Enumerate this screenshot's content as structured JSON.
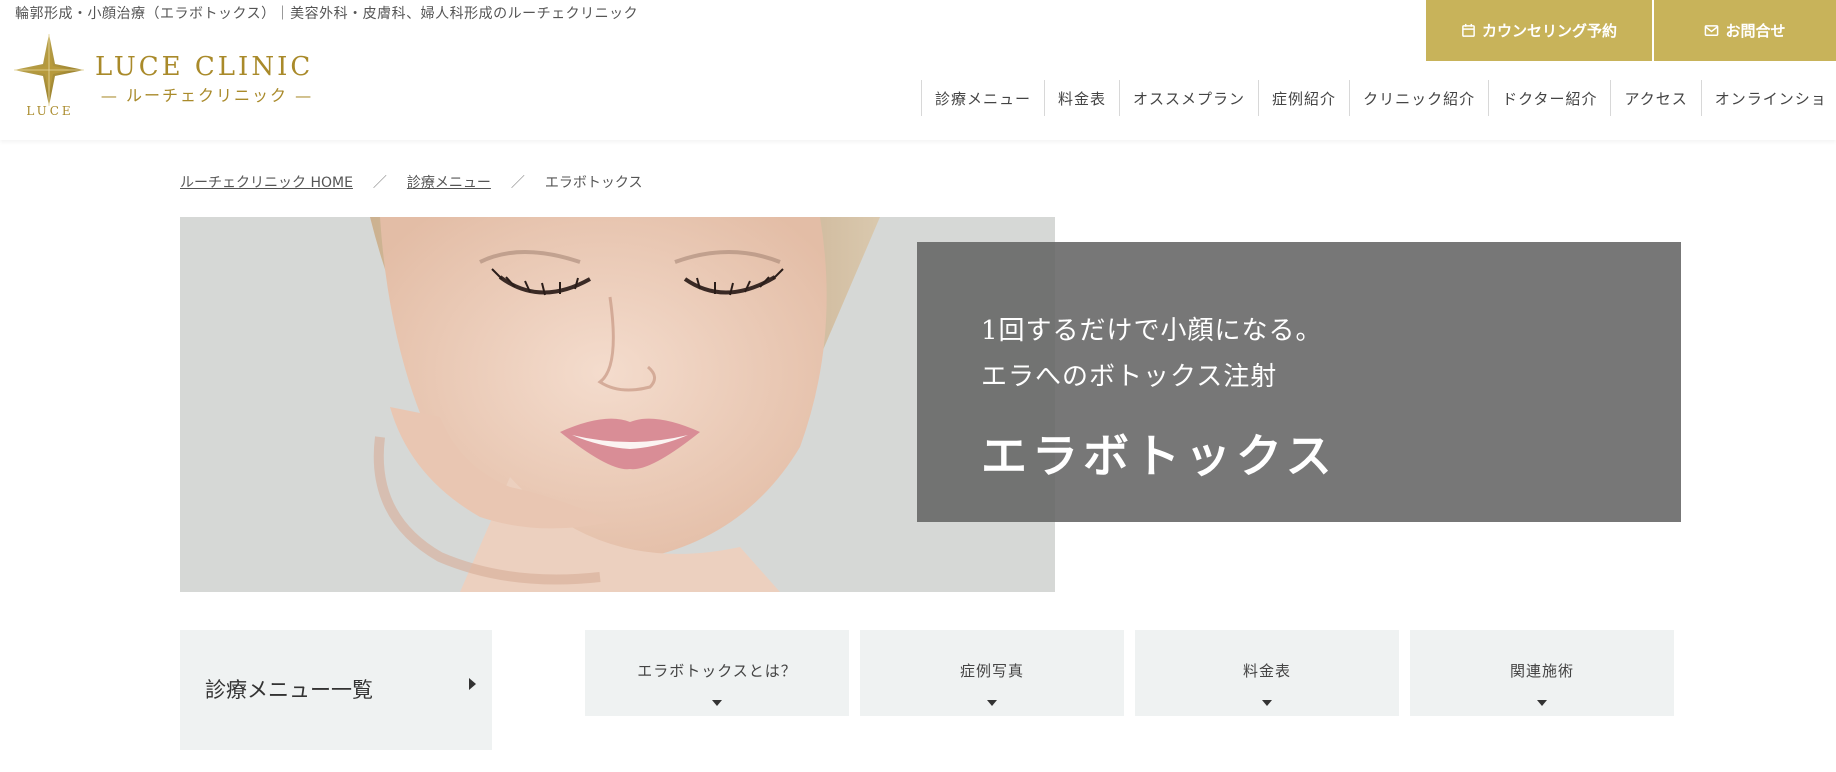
{
  "header": {
    "tagline": "輪郭形成・小顔治療（エラボトックス）｜美容外科・皮膚科、婦人科形成のルーチェクリニック",
    "logo": {
      "mark_text": "LUCE",
      "name": "LUCE CLINIC",
      "sub": "— ルーチェクリニック —"
    },
    "buttons": {
      "counseling": "カウンセリング予約",
      "contact": "お問合せ"
    },
    "nav": [
      "診療メニュー",
      "料金表",
      "オススメプラン",
      "症例紹介",
      "クリニック紹介",
      "ドクター紹介",
      "アクセス",
      "オンラインショ"
    ]
  },
  "breadcrumb": {
    "home": "ルーチェクリニック HOME",
    "sep": "／",
    "menu": "診療メニュー",
    "current": "エラボトックス"
  },
  "hero": {
    "lead_line1": "1回するだけで小顔になる。",
    "lead_line2": "エラへのボトックス注射",
    "title": "エラボトックス"
  },
  "sidebar": {
    "menu_list_label": "診療メニュー一覧"
  },
  "tabs": [
    "エラボトックスとは？",
    "症例写真",
    "料金表",
    "関連施術"
  ],
  "colors": {
    "gold": "#c8b35a",
    "logo_gold": "#a98a2a",
    "panel_gray": "#eff2f2",
    "overlay": "#646464"
  },
  "icons": {
    "counseling": "calendar-icon",
    "contact": "envelope-icon",
    "menu_list": "caret-right-icon",
    "tab": "caret-down-icon"
  }
}
